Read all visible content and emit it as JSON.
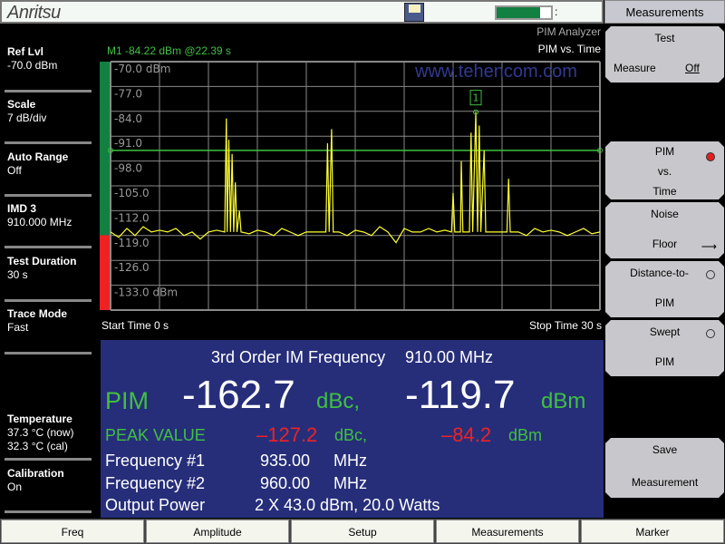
{
  "header": {
    "brand": "Anritsu",
    "battery_level_percent": 80,
    "save_icon": "floppy-disk-icon"
  },
  "left_panel": [
    {
      "label": "Ref Lvl",
      "value": "-70.0 dBm"
    },
    {
      "label": "Scale",
      "value": "7 dB/div"
    },
    {
      "label": "Auto Range",
      "value": "Off"
    },
    {
      "label": "IMD 3",
      "value": "910.000 MHz"
    },
    {
      "label": "Test Duration",
      "value": "30 s"
    },
    {
      "label": "Trace Mode",
      "value": "Fast"
    }
  ],
  "temperature": {
    "label": "Temperature",
    "now": "37.3 °C  (now)",
    "cal": "32.3 °C  (cal)"
  },
  "calibration": {
    "label": "Calibration",
    "value": "On"
  },
  "marker_readout": "M1 -84.22 dBm @22.39 s",
  "mode": {
    "analyzer": "PIM Analyzer",
    "view": "PIM vs. Time"
  },
  "watermark": "www.tehencom.com",
  "time_axis": {
    "start": "Start Time 0 s",
    "stop": "Stop Time  30 s"
  },
  "chart_data": {
    "type": "line",
    "xlim": [
      0,
      30
    ],
    "ylim": [
      -140,
      -70
    ],
    "x_unit": "s",
    "y_unit": "dBm",
    "y_tick_labels": [
      "-70.0 dBm",
      "-77.0",
      "-84.0",
      "-91.0",
      "-98.0",
      "-105.0",
      "-112.0",
      "-119.0",
      "-126.0",
      "-133.0 dBm"
    ],
    "grid": true,
    "threshold_dBm": -95,
    "colors": {
      "trace": "#ffff30",
      "threshold": "#40c040",
      "pass_bar": "#128040",
      "fail_bar": "#ee2222",
      "grid": "#888888"
    },
    "marker": {
      "label": "1",
      "time": 22.39,
      "value": -84.22
    },
    "trace": [
      [
        0,
        -118
      ],
      [
        0.5,
        -119.5
      ],
      [
        1,
        -117
      ],
      [
        1.5,
        -119
      ],
      [
        2,
        -116.5
      ],
      [
        2.5,
        -118
      ],
      [
        3,
        -117.5
      ],
      [
        3.5,
        -118
      ],
      [
        4,
        -117
      ],
      [
        4.5,
        -119
      ],
      [
        5,
        -118
      ],
      [
        5.5,
        -120
      ],
      [
        6,
        -118
      ],
      [
        6.5,
        -117.5
      ],
      [
        7,
        -118
      ],
      [
        7.05,
        -100
      ],
      [
        7.1,
        -86
      ],
      [
        7.15,
        -118
      ],
      [
        7.25,
        -92
      ],
      [
        7.35,
        -118
      ],
      [
        7.45,
        -96
      ],
      [
        7.55,
        -118
      ],
      [
        7.65,
        -104
      ],
      [
        7.75,
        -118
      ],
      [
        7.9,
        -112
      ],
      [
        8,
        -118
      ],
      [
        8.5,
        -118.5
      ],
      [
        9,
        -117.5
      ],
      [
        9.5,
        -118
      ],
      [
        10,
        -119
      ],
      [
        10.5,
        -117
      ],
      [
        11,
        -118
      ],
      [
        11.5,
        -119
      ],
      [
        12,
        -118
      ],
      [
        12.5,
        -118
      ],
      [
        13.2,
        -118
      ],
      [
        13.3,
        -93
      ],
      [
        13.4,
        -118
      ],
      [
        13.55,
        -89
      ],
      [
        13.65,
        -118
      ],
      [
        14,
        -118
      ],
      [
        14.5,
        -119
      ],
      [
        15,
        -117.5
      ],
      [
        15.5,
        -118
      ],
      [
        16,
        -119
      ],
      [
        16.5,
        -116.5
      ],
      [
        17,
        -118
      ],
      [
        17.5,
        -121
      ],
      [
        18,
        -117
      ],
      [
        18.5,
        -118
      ],
      [
        19,
        -118
      ],
      [
        19.5,
        -117
      ],
      [
        20,
        -118
      ],
      [
        20.5,
        -117.5
      ],
      [
        20.9,
        -118
      ],
      [
        21,
        -107
      ],
      [
        21.1,
        -118
      ],
      [
        21.45,
        -118
      ],
      [
        21.5,
        -98
      ],
      [
        21.6,
        -118
      ],
      [
        22,
        -118
      ],
      [
        22.1,
        -90
      ],
      [
        22.2,
        -118
      ],
      [
        22.39,
        -84.22
      ],
      [
        22.5,
        -118
      ],
      [
        22.6,
        -88
      ],
      [
        22.7,
        -118
      ],
      [
        22.9,
        -95
      ],
      [
        23,
        -118
      ],
      [
        24.3,
        -118
      ],
      [
        24.4,
        -103
      ],
      [
        24.5,
        -118
      ],
      [
        25,
        -118
      ],
      [
        25.5,
        -119
      ],
      [
        26,
        -117
      ],
      [
        26.5,
        -118
      ],
      [
        27,
        -117.5
      ],
      [
        27.5,
        -118
      ],
      [
        28,
        -119
      ],
      [
        28.5,
        -118
      ],
      [
        29,
        -117
      ],
      [
        29.5,
        -118.5
      ],
      [
        30,
        -118
      ]
    ]
  },
  "results": {
    "im_label": "3rd Order IM Frequency",
    "im_value": "910.00 MHz",
    "pim_label": "PIM",
    "pim_dbc": "-162.7",
    "dbc_unit": "dBc,",
    "pim_dbm": "-119.7",
    "dbm_unit": "dBm",
    "peak_label": "PEAK VALUE",
    "peak_dbc": "–127.2",
    "peak_dbm": "–84.2",
    "f1_label": "Frequency #1",
    "f1_value": "935.00",
    "f2_label": "Frequency #2",
    "f2_value": "960.00",
    "mhz": "MHz",
    "power_label": "Output Power",
    "power_value": "2 X 43.0 dBm, 20.0 Watts"
  },
  "softkeys": {
    "title": "Measurements",
    "test": {
      "line1": "Test",
      "line2": "Measure",
      "state": "Off"
    },
    "pim_vs_time": {
      "l1": "PIM",
      "l2": "vs.",
      "l3": "Time",
      "selected": true
    },
    "noise_floor": {
      "l1": "Noise",
      "l2": "Floor"
    },
    "dtp": {
      "l1": "Distance-to-",
      "l2": "PIM",
      "selected": false
    },
    "swept": {
      "l1": "Swept",
      "l2": "PIM",
      "selected": false
    },
    "save": {
      "l1": "Save",
      "l2": "Measurement"
    }
  },
  "bottom_menu": [
    "Freq",
    "Amplitude",
    "Setup",
    "Measurements",
    "Marker"
  ]
}
